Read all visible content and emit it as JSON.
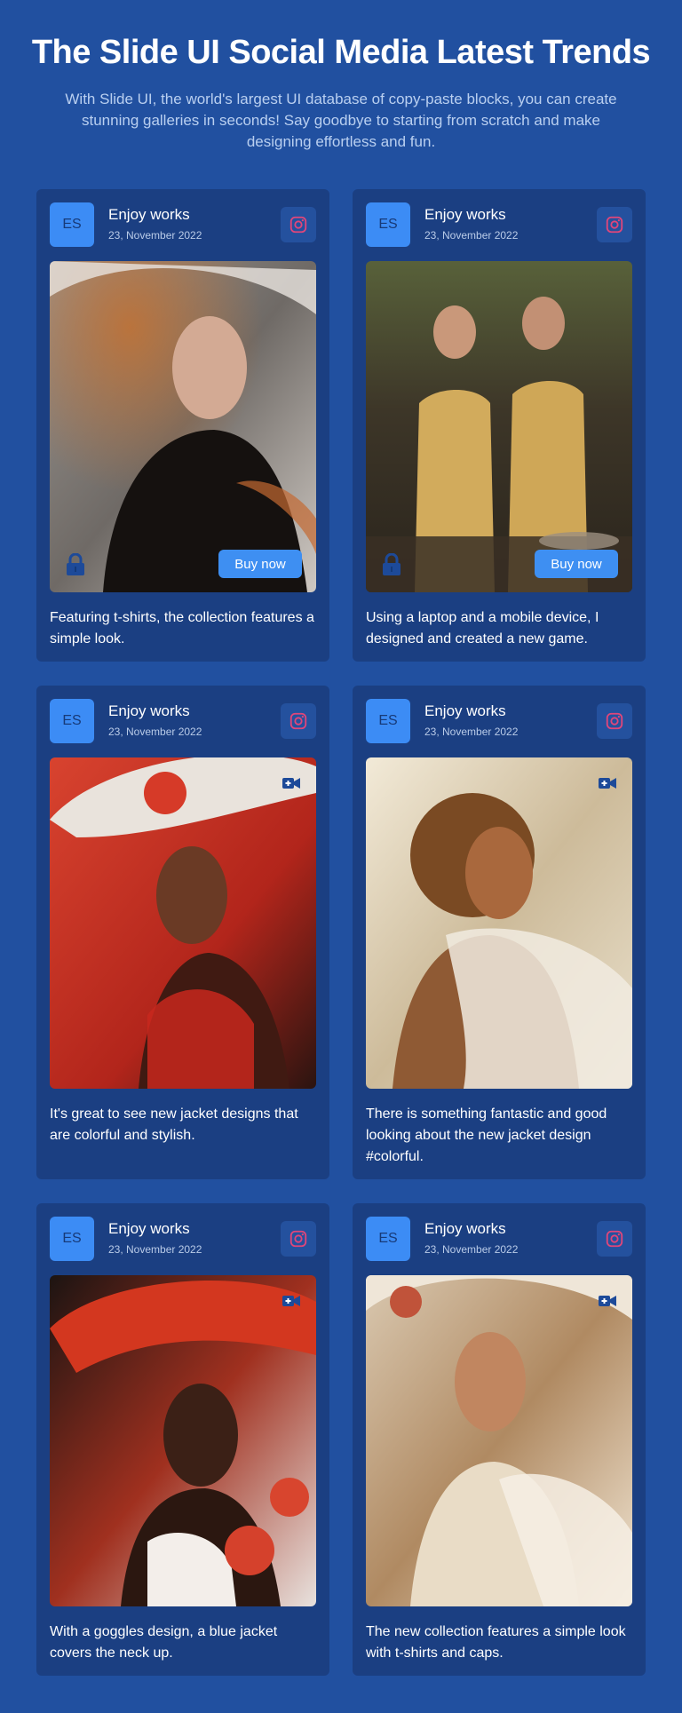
{
  "header": {
    "title": "The Slide UI Social Media Latest Trends",
    "subtitle": "With Slide UI, the world's largest UI database of copy-paste blocks, you can create stunning galleries in seconds! Say goodbye to starting from scratch and make designing effortless and fun."
  },
  "colors": {
    "background": "#2150a0",
    "card": "#1b3f82",
    "accent": "#3c8cf5"
  },
  "posts": [
    {
      "initials": "ES",
      "author": "Enjoy works",
      "date": "23, November 2022",
      "social_icon": "instagram-icon",
      "media_icon": "lock-icon",
      "buy_label": "Buy now",
      "caption": "Featuring t-shirts, the collection features a simple look."
    },
    {
      "initials": "ES",
      "author": "Enjoy works",
      "date": "23, November 2022",
      "social_icon": "instagram-icon",
      "media_icon": "lock-icon",
      "buy_label": "Buy now",
      "caption": "Using a laptop and a mobile device, I designed and created a new game."
    },
    {
      "initials": "ES",
      "author": "Enjoy works",
      "date": "23, November 2022",
      "social_icon": "instagram-icon",
      "media_icon": "video-icon",
      "caption": "It's great to see new jacket designs that are colorful and stylish."
    },
    {
      "initials": "ES",
      "author": "Enjoy works",
      "date": "23, November 2022",
      "social_icon": "instagram-icon",
      "media_icon": "video-icon",
      "caption": "There is something fantastic and good looking about the new jacket design #colorful."
    },
    {
      "initials": "ES",
      "author": "Enjoy works",
      "date": "23, November 2022",
      "social_icon": "instagram-icon",
      "media_icon": "video-icon",
      "caption": "With a goggles design, a blue jacket covers the neck up."
    },
    {
      "initials": "ES",
      "author": "Enjoy works",
      "date": "23, November 2022",
      "social_icon": "instagram-icon",
      "media_icon": "video-icon",
      "caption": "The new collection features a simple look with t-shirts and caps."
    }
  ]
}
